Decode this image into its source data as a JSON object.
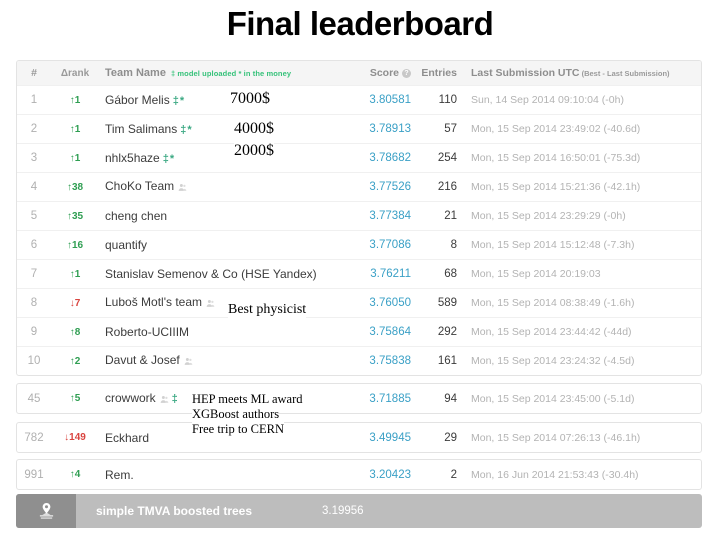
{
  "slide": {
    "title": "Final leaderboard"
  },
  "table": {
    "headers": {
      "rank": "#",
      "delta_rank": "Δrank",
      "team_name": "Team Name",
      "legend": "‡ model uploaded * in the money",
      "score": "Score",
      "score_help_icon": "question-mark-icon",
      "entries": "Entries",
      "last_submission": "Last Submission UTC",
      "last_submission_note": "(Best - Last Submission)"
    },
    "groups": [
      {
        "rows": [
          {
            "rank": "1",
            "delta": "↑1",
            "delta_dir": "up",
            "team": "Gábor Melis",
            "model_uploaded": "‡",
            "in_money": "*",
            "has_team_icon": false,
            "score": "3.80581",
            "entries": "110",
            "submission": "Sun, 14 Sep 2014 09:10:04 (-0h)"
          },
          {
            "rank": "2",
            "delta": "↑1",
            "delta_dir": "up",
            "team": "Tim Salimans",
            "model_uploaded": "‡",
            "in_money": "*",
            "has_team_icon": false,
            "score": "3.78913",
            "entries": "57",
            "submission": "Mon, 15 Sep 2014 23:49:02 (-40.6d)"
          },
          {
            "rank": "3",
            "delta": "↑1",
            "delta_dir": "up",
            "team": "nhlx5haze",
            "model_uploaded": "‡",
            "in_money": "*",
            "has_team_icon": false,
            "score": "3.78682",
            "entries": "254",
            "submission": "Mon, 15 Sep 2014 16:50:01 (-75.3d)"
          },
          {
            "rank": "4",
            "delta": "↑38",
            "delta_dir": "up",
            "team": "ChoKo Team",
            "model_uploaded": "",
            "in_money": "",
            "has_team_icon": true,
            "score": "3.77526",
            "entries": "216",
            "submission": "Mon, 15 Sep 2014 15:21:36 (-42.1h)"
          },
          {
            "rank": "5",
            "delta": "↑35",
            "delta_dir": "up",
            "team": "cheng chen",
            "model_uploaded": "",
            "in_money": "",
            "has_team_icon": false,
            "score": "3.77384",
            "entries": "21",
            "submission": "Mon, 15 Sep 2014 23:29:29 (-0h)"
          },
          {
            "rank": "6",
            "delta": "↑16",
            "delta_dir": "up",
            "team": "quantify",
            "model_uploaded": "",
            "in_money": "",
            "has_team_icon": false,
            "score": "3.77086",
            "entries": "8",
            "submission": "Mon, 15 Sep 2014 15:12:48 (-7.3h)"
          },
          {
            "rank": "7",
            "delta": "↑1",
            "delta_dir": "up",
            "team": "Stanislav Semenov & Co (HSE Yandex)",
            "model_uploaded": "",
            "in_money": "",
            "has_team_icon": false,
            "score": "3.76211",
            "entries": "68",
            "submission": "Mon, 15 Sep 2014 20:19:03"
          },
          {
            "rank": "8",
            "delta": "↓7",
            "delta_dir": "down",
            "team": "Luboš Motl's team",
            "model_uploaded": "",
            "in_money": "",
            "has_team_icon": true,
            "score": "3.76050",
            "entries": "589",
            "submission": "Mon, 15 Sep 2014 08:38:49 (-1.6h)"
          },
          {
            "rank": "9",
            "delta": "↑8",
            "delta_dir": "up",
            "team": "Roberto-UCIIIM",
            "model_uploaded": "",
            "in_money": "",
            "has_team_icon": false,
            "score": "3.75864",
            "entries": "292",
            "submission": "Mon, 15 Sep 2014 23:44:42 (-44d)"
          },
          {
            "rank": "10",
            "delta": "↑2",
            "delta_dir": "up",
            "team": "Davut & Josef",
            "model_uploaded": "",
            "in_money": "",
            "has_team_icon": true,
            "score": "3.75838",
            "entries": "161",
            "submission": "Mon, 15 Sep 2014 23:24:32 (-4.5d)"
          }
        ]
      },
      {
        "rows": [
          {
            "rank": "45",
            "delta": "↑5",
            "delta_dir": "up",
            "team": "crowwork",
            "model_uploaded": "‡",
            "in_money": "",
            "has_team_icon": true,
            "score": "3.71885",
            "entries": "94",
            "submission": "Mon, 15 Sep 2014 23:45:00 (-5.1d)"
          }
        ]
      },
      {
        "rows": [
          {
            "rank": "782",
            "delta": "↓149",
            "delta_dir": "down",
            "team": "Eckhard",
            "model_uploaded": "",
            "in_money": "",
            "has_team_icon": false,
            "score": "3.49945",
            "entries": "29",
            "submission": "Mon, 15 Sep 2014 07:26:13 (-46.1h)"
          }
        ]
      },
      {
        "rows": [
          {
            "rank": "991",
            "delta": "↑4",
            "delta_dir": "up",
            "team": "Rem.",
            "model_uploaded": "",
            "in_money": "",
            "has_team_icon": false,
            "score": "3.20423",
            "entries": "2",
            "submission": "Mon, 16 Jun 2014 21:53:43 (-30.4h)"
          }
        ]
      }
    ],
    "benchmark_row": {
      "icon": "benchmark-marker-icon",
      "team": "simple TMVA boosted trees",
      "score": "3.19956"
    }
  },
  "annotations": {
    "prize_first": "7000$",
    "prize_second": "4000$",
    "prize_third": "2000$",
    "best_physicist": "Best physicist",
    "hep_award_line1": "HEP meets ML award",
    "hep_award_line2": "XGBoost authors",
    "hep_award_line3": "Free trip to CERN"
  },
  "colors": {
    "score": "#3aa0c6",
    "up": "#2f9e52",
    "down": "#d9443f",
    "legend_green": "#36c27a",
    "benchmark_bg": "#bdbdbd"
  }
}
